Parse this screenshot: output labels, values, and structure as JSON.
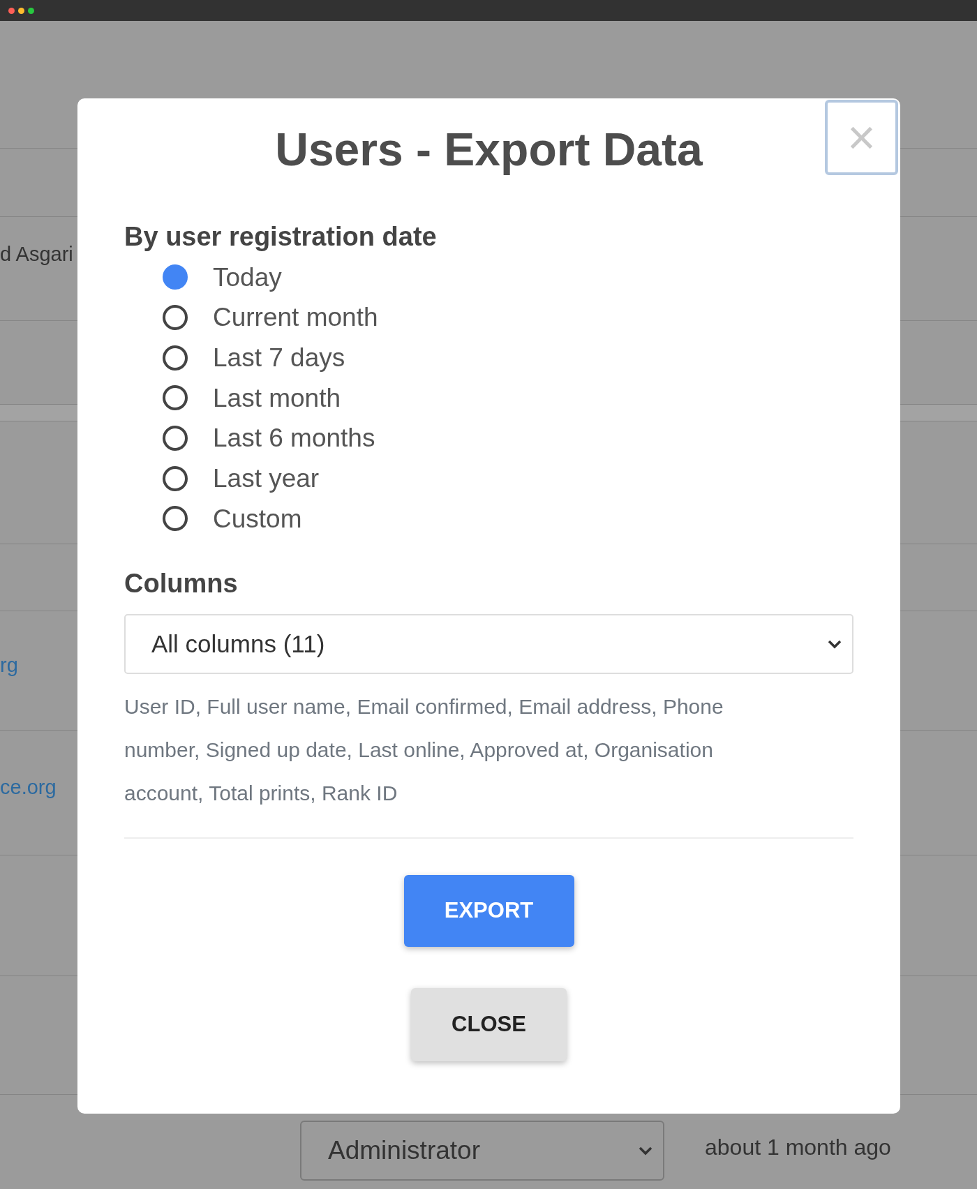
{
  "background_rows": [
    {
      "kind": "text",
      "text": "d Asgari"
    },
    {
      "kind": "link",
      "text": "rg"
    },
    {
      "kind": "link",
      "text": "ce.org"
    }
  ],
  "background_footer": {
    "role_select": "Administrator",
    "last_online": "about 1 month ago"
  },
  "dialog": {
    "title": "Users - Export Data",
    "close_glyph": "×",
    "date_filter": {
      "heading": "By user registration date",
      "options": [
        {
          "label": "Today",
          "selected": true
        },
        {
          "label": "Current month",
          "selected": false
        },
        {
          "label": "Last 7 days",
          "selected": false
        },
        {
          "label": "Last month",
          "selected": false
        },
        {
          "label": "Last 6 months",
          "selected": false
        },
        {
          "label": "Last year",
          "selected": false
        },
        {
          "label": "Custom",
          "selected": false
        }
      ]
    },
    "columns": {
      "heading": "Columns",
      "select_value": "All columns (11)",
      "help_text": "User ID, Full user name, Email confirmed, Email address, Phone number, Signed up date, Last online, Approved at, Organisation account, Total prints, Rank ID"
    },
    "buttons": [
      {
        "label": "EXPORT",
        "kind": "primary"
      },
      {
        "label": "CLOSE",
        "kind": "secondary"
      }
    ]
  }
}
